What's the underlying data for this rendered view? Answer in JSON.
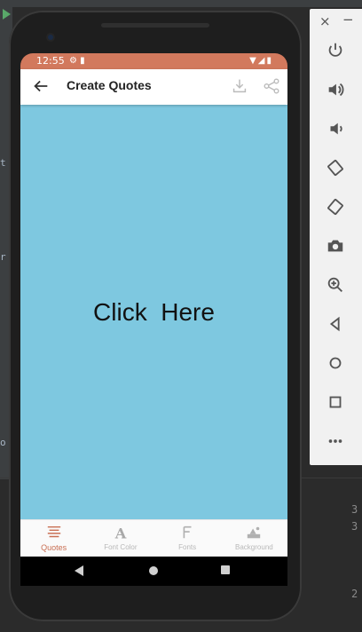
{
  "app": {
    "title": "Create Quotes",
    "canvas_text": "Click  Here",
    "canvas_color": "#7ec8e0",
    "accent_color": "#d2795d"
  },
  "status_bar": {
    "time": "12:55",
    "left_icons": [
      "gear-icon",
      "sd-card-icon"
    ],
    "right_icons": [
      "wifi-icon",
      "signal-icon",
      "battery-icon"
    ]
  },
  "app_bar": {
    "back_icon": "arrow-left-icon",
    "actions": [
      "download-icon",
      "share-icon"
    ]
  },
  "bottom_nav": {
    "items": [
      {
        "label": "Quotes",
        "icon": "quotes-icon",
        "active": true
      },
      {
        "label": "Font Color",
        "icon": "font-color-icon",
        "active": false
      },
      {
        "label": "Fonts",
        "icon": "fonts-icon",
        "active": false
      },
      {
        "label": "Background",
        "icon": "background-icon",
        "active": false
      }
    ]
  },
  "emulator_toolbar": {
    "close": "×",
    "minimize": "−",
    "buttons": [
      "power-icon",
      "volume-up-icon",
      "volume-down-icon",
      "rotate-left-icon",
      "rotate-right-icon",
      "camera-icon",
      "zoom-icon",
      "back-icon",
      "home-icon",
      "overview-icon",
      "more-icon"
    ]
  },
  "ide": {
    "left_chars": [
      "t",
      "r",
      "o"
    ],
    "right_numbers": [
      "3",
      "3",
      "2"
    ]
  }
}
